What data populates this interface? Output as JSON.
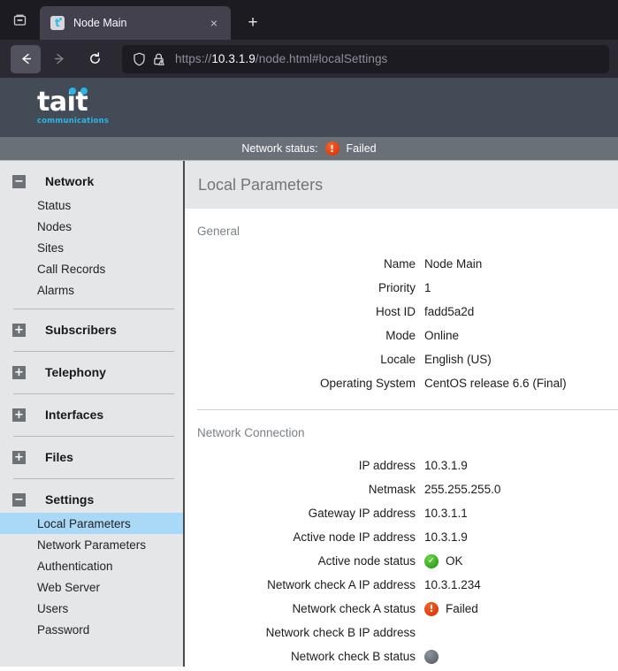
{
  "browser": {
    "tab_list_icon": "tab-list-icon",
    "tab": {
      "title": "Node Main",
      "favicon_letter": "t",
      "close_label": "×"
    },
    "new_tab_label": "+",
    "nav": {
      "back_icon": "back-arrow-icon",
      "forward_icon": "forward-arrow-icon",
      "reload_icon": "reload-icon"
    },
    "urlbar": {
      "shield_icon": "shield-icon",
      "lock_warning_icon": "lock-warning-icon",
      "url_prefix": "https://",
      "url_host": "10.3.1.9",
      "url_path": "/node.html#localSettings"
    }
  },
  "app": {
    "logo_word": "tait",
    "logo_sub": "communications",
    "status": {
      "label": "Network status:",
      "icon": "failed-icon",
      "value": "Failed"
    }
  },
  "sidebar": {
    "groups": [
      {
        "toggle": "−",
        "title": "Network",
        "items": [
          "Status",
          "Nodes",
          "Sites",
          "Call Records",
          "Alarms"
        ]
      },
      {
        "toggle": "+",
        "title": "Subscribers",
        "items": []
      },
      {
        "toggle": "+",
        "title": "Telephony",
        "items": []
      },
      {
        "toggle": "+",
        "title": "Interfaces",
        "items": []
      },
      {
        "toggle": "+",
        "title": "Files",
        "items": []
      },
      {
        "toggle": "−",
        "title": "Settings",
        "items": [
          "Local Parameters",
          "Network Parameters",
          "Authentication",
          "Web Server",
          "Users",
          "Password"
        ],
        "active_item": "Local Parameters"
      }
    ]
  },
  "content": {
    "title": "Local Parameters",
    "sections": [
      {
        "title": "General",
        "rows": [
          {
            "label": "Name",
            "value": "Node Main"
          },
          {
            "label": "Priority",
            "value": "1"
          },
          {
            "label": "Host ID",
            "value": "fadd5a2d"
          },
          {
            "label": "Mode",
            "value": "Online"
          },
          {
            "label": "Locale",
            "value": "English (US)"
          },
          {
            "label": "Operating System",
            "value": "CentOS release 6.6 (Final)"
          }
        ]
      },
      {
        "title": "Network Connection",
        "rows": [
          {
            "label": "IP address",
            "value": "10.3.1.9"
          },
          {
            "label": "Netmask",
            "value": "255.255.255.0"
          },
          {
            "label": "Gateway IP address",
            "value": "10.3.1.1"
          },
          {
            "label": "Active node IP address",
            "value": "10.3.1.9"
          },
          {
            "label": "Active node status",
            "value": "OK",
            "icon": "ok"
          },
          {
            "label": "Network check A IP address",
            "value": "10.3.1.234"
          },
          {
            "label": "Network check A status",
            "value": "Failed",
            "icon": "fail"
          },
          {
            "label": "Network check B IP address",
            "value": ""
          },
          {
            "label": "Network check B status",
            "value": "",
            "icon": "none"
          }
        ]
      }
    ]
  },
  "colors": {
    "header_bg": "#434c56",
    "status_bg": "#6a7078",
    "accent_cyan": "#29b6e8",
    "active_item": "#a9d9f7",
    "ok_green": "#2fa81a",
    "fail_orange": "#e13c0c"
  }
}
